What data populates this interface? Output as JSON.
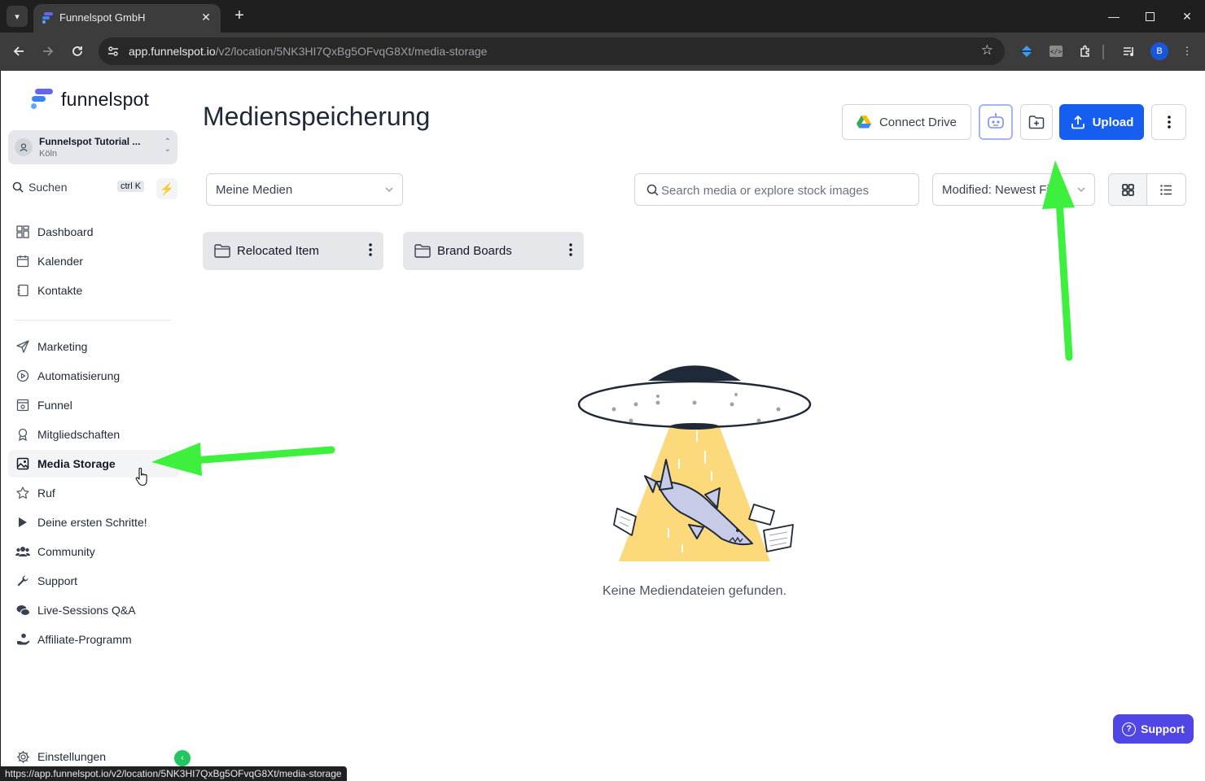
{
  "browser": {
    "tab_title": "Funnelspot GmbH",
    "url_host": "app.funnelspot.io",
    "url_path": "/v2/location/5NK3HI7QxBg5OFvqG8Xt/media-storage",
    "profile_initial": "B",
    "status_url": "https://app.funnelspot.io/v2/location/5NK3HI7QxBg5OFvqG8Xt/media-storage"
  },
  "sidebar": {
    "logo_text": "funnelspot",
    "account": {
      "name": "Funnelspot Tutorial ...",
      "location": "Köln"
    },
    "search": {
      "label": "Suchen",
      "shortcut": "ctrl K"
    },
    "items": [
      {
        "label": "Dashboard",
        "icon": "dashboard-icon"
      },
      {
        "label": "Kalender",
        "icon": "calendar-icon"
      },
      {
        "label": "Kontakte",
        "icon": "contacts-icon"
      },
      {
        "label": "Marketing",
        "icon": "send-icon"
      },
      {
        "label": "Automatisierung",
        "icon": "automation-icon"
      },
      {
        "label": "Funnel",
        "icon": "funnel-icon"
      },
      {
        "label": "Mitgliedschaften",
        "icon": "membership-icon"
      },
      {
        "label": "Media Storage",
        "icon": "image-icon",
        "active": true
      },
      {
        "label": "Ruf",
        "icon": "star-icon"
      },
      {
        "label": "Deine ersten Schritte!",
        "icon": "play-icon"
      },
      {
        "label": "Community",
        "icon": "users-icon"
      },
      {
        "label": "Support",
        "icon": "wrench-icon"
      },
      {
        "label": "Live-Sessions Q&A",
        "icon": "chat-icon"
      },
      {
        "label": "Affiliate-Programm",
        "icon": "hand-icon"
      }
    ],
    "settings_label": "Einstellungen"
  },
  "main": {
    "title": "Medienspeicherung",
    "buttons": {
      "connect_drive": "Connect Drive",
      "upload": "Upload"
    },
    "filter_value": "Meine Medien",
    "search_placeholder": "Search media or explore stock images",
    "sort_value": "Modified: Newest First",
    "folders": [
      {
        "name": "Relocated Item"
      },
      {
        "name": "Brand Boards"
      }
    ],
    "empty_text": "Keine Mediendateien gefunden."
  },
  "support_button": "Support",
  "colors": {
    "primary": "#155eef",
    "annotation_arrow": "#3ef03e",
    "support": "#4f46e5"
  }
}
